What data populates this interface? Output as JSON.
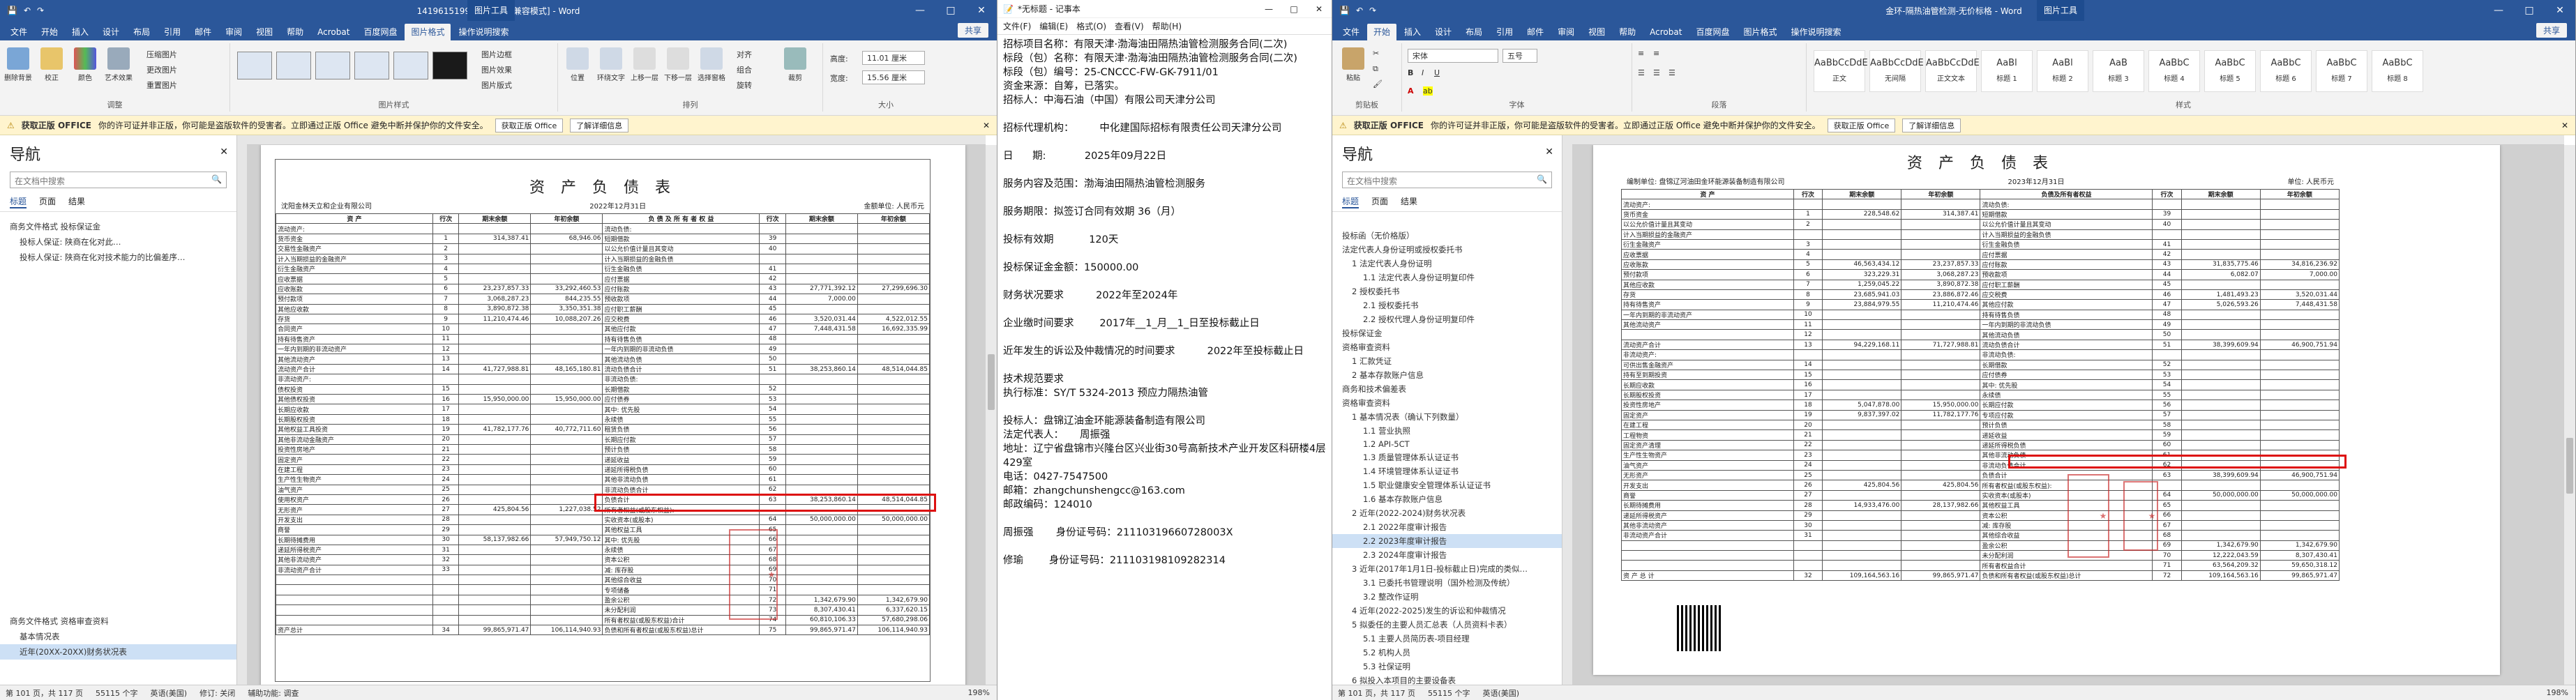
{
  "w1": {
    "title": "14196151993985792 [兼容模式] - Word",
    "context_tab": "图片工具",
    "tabs": [
      "文件",
      "开始",
      "插入",
      "设计",
      "布局",
      "引用",
      "邮件",
      "审阅",
      "视图",
      "帮助",
      "Acrobat",
      "百度网盘",
      "图片格式",
      "操作说明搜索"
    ],
    "active_tab": "图片格式",
    "share": "共享",
    "ribbon": {
      "groups": [
        "调整",
        "图片样式",
        "排列",
        "大小"
      ],
      "adjust_buttons": [
        "删除背景",
        "校正",
        "颜色",
        "艺术效果"
      ],
      "adjust_small": [
        "压缩图片",
        "更改图片",
        "重置图片"
      ],
      "picstyle_small": [
        "图片边框",
        "图片效果",
        "图片版式"
      ],
      "arrange_buttons": [
        "位置",
        "环绕文字",
        "上移一层",
        "下移一层",
        "选择窗格"
      ],
      "arrange_small": [
        "对齐",
        "组合",
        "旋转"
      ],
      "crop": "裁剪",
      "height_label": "高度:",
      "height_value": "11.01 厘米",
      "width_label": "宽度:",
      "width_value": "15.56 厘米"
    },
    "msgbar": {
      "label": "获取正版 OFFICE",
      "text": "你的许可证并非正版，你可能是盗版软件的受害者。立即通过正版 Office 避免中断并保护你的文件安全。",
      "btn1": "获取正版 Office",
      "btn2": "了解详细信息"
    },
    "nav": {
      "title": "导航",
      "search_placeholder": "在文档中搜索",
      "tabs": [
        "标题",
        "页面",
        "结果"
      ],
      "items": [
        "商务文件格式 投标保证金",
        "投标人保证: 陕商在化对此…",
        "投标人保证: 陕商在化对技术能力的比偏差序…",
        "商务文件格式 资格审查资料",
        "基本情况表",
        "近年(20XX-20XX)财务状况表"
      ]
    },
    "status": {
      "page": "第 101 页，共 117 页",
      "words": "55115 个字",
      "lang": "英语(美国)",
      "track": "修订: 关闭",
      "access": "辅助功能: 调查",
      "zoom": "198%"
    },
    "sheet": {
      "title": "资 产 负 债 表",
      "company": "沈阳金林天立和企业有限公司",
      "date": "2022年12月31日",
      "unit": "金额单位: 人民币元",
      "form": "会企01表",
      "headers": [
        "资 产",
        "行次",
        "期末余额",
        "年初余额",
        "负 债 及 所 有 者 权 益",
        "行次",
        "期末余额",
        "年初余额"
      ],
      "rows": [
        [
          "流动资产:",
          "",
          "",
          "",
          "流动负债:",
          "",
          "",
          ""
        ],
        [
          "货币资金",
          "1",
          "314,387.41",
          "68,946.06",
          "短期借款",
          "39",
          "",
          ""
        ],
        [
          "交易性金融资产",
          "2",
          "",
          "",
          "以公允价值计量且其变动",
          "40",
          "",
          ""
        ],
        [
          "计入当期损益的金融资产",
          "3",
          "",
          "",
          "计入当期损益的金融负债",
          "",
          "",
          ""
        ],
        [
          "衍生金融资产",
          "4",
          "",
          "",
          "衍生金融负债",
          "41",
          "",
          ""
        ],
        [
          "应收票据",
          "5",
          "",
          "",
          "应付票据",
          "42",
          "",
          ""
        ],
        [
          "应收账款",
          "6",
          "23,237,857.33",
          "33,292,460.53",
          "应付账款",
          "43",
          "27,771,392.12",
          "27,299,696.30"
        ],
        [
          "预付款项",
          "7",
          "3,068,287.23",
          "844,235.55",
          "预收款项",
          "44",
          "7,000.00",
          ""
        ],
        [
          "其他应收款",
          "8",
          "3,890,872.38",
          "3,350,351.38",
          "应付职工薪酬",
          "45",
          "",
          ""
        ],
        [
          "存货",
          "9",
          "11,210,474.46",
          "10,088,207.26",
          "应交税费",
          "46",
          "3,520,031.44",
          "4,522,012.55"
        ],
        [
          "合同资产",
          "10",
          "",
          "",
          "其他应付款",
          "47",
          "7,448,431.58",
          "16,692,335.99"
        ],
        [
          "持有待售资产",
          "11",
          "",
          "",
          "持有待售负债",
          "48",
          "",
          ""
        ],
        [
          "一年内到期的非流动资产",
          "12",
          "",
          "",
          "一年内到期的非流动负债",
          "49",
          "",
          ""
        ],
        [
          "其他流动资产",
          "13",
          "",
          "",
          "其他流动负债",
          "50",
          "",
          ""
        ],
        [
          "流动资产合计",
          "14",
          "41,727,988.81",
          "48,165,180.81",
          "流动负债合计",
          "51",
          "38,253,860.14",
          "48,514,044.85"
        ],
        [
          "非流动资产:",
          "",
          "",
          "",
          "非流动负债:",
          "",
          "",
          ""
        ],
        [
          "债权投资",
          "15",
          "",
          "",
          "长期借款",
          "52",
          "",
          ""
        ],
        [
          "其他债权投资",
          "16",
          "15,950,000.00",
          "15,950,000.00",
          "应付债券",
          "53",
          "",
          ""
        ],
        [
          "长期应收款",
          "17",
          "",
          "",
          "其中: 优先股",
          "54",
          "",
          ""
        ],
        [
          "长期股权投资",
          "18",
          "",
          "",
          "永续债",
          "55",
          "",
          ""
        ],
        [
          "其他权益工具投资",
          "19",
          "41,782,177.76",
          "40,772,711.60",
          "租赁负债",
          "56",
          "",
          ""
        ],
        [
          "其他非流动金融资产",
          "20",
          "",
          "",
          "长期应付款",
          "57",
          "",
          ""
        ],
        [
          "投资性房地产",
          "21",
          "",
          "",
          "预计负债",
          "58",
          "",
          ""
        ],
        [
          "固定资产",
          "22",
          "",
          "",
          "递延收益",
          "59",
          "",
          ""
        ],
        [
          "在建工程",
          "23",
          "",
          "",
          "递延所得税负债",
          "60",
          "",
          ""
        ],
        [
          "生产性生物资产",
          "24",
          "",
          "",
          "其他非流动负债",
          "61",
          "",
          ""
        ],
        [
          "油气资产",
          "25",
          "",
          "",
          "非流动负债合计",
          "62",
          "",
          ""
        ],
        [
          "使用权资产",
          "26",
          "",
          "",
          "负债合计",
          "63",
          "38,253,860.14",
          "48,514,044.85"
        ],
        [
          "无形资产",
          "27",
          "425,804.56",
          "1,227,038.52",
          "所有者权益(或股东权益):",
          "",
          "",
          ""
        ],
        [
          "开发支出",
          "28",
          "",
          "",
          "实收资本(或股本)",
          "64",
          "50,000,000.00",
          "50,000,000.00"
        ],
        [
          "商誉",
          "29",
          "",
          "",
          "其他权益工具",
          "65",
          "",
          ""
        ],
        [
          "长期待摊费用",
          "30",
          "58,137,982.66",
          "57,949,750.12",
          "其中: 优先股",
          "66",
          "",
          ""
        ],
        [
          "递延所得税资产",
          "31",
          "",
          "",
          "永续债",
          "67",
          "",
          ""
        ],
        [
          "其他非流动资产",
          "32",
          "",
          "",
          "资本公积",
          "68",
          "",
          ""
        ],
        [
          "非流动资产合计",
          "33",
          "",
          "",
          "减: 库存股",
          "69",
          "",
          ""
        ],
        [
          "",
          "",
          "",
          "",
          "其他综合收益",
          "70",
          "",
          ""
        ],
        [
          "",
          "",
          "",
          "",
          "专项储备",
          "71",
          "",
          ""
        ],
        [
          "",
          "",
          "",
          "",
          "盈余公积",
          "72",
          "1,342,679.90",
          "1,342,679.90"
        ],
        [
          "",
          "",
          "",
          "",
          "未分配利润",
          "73",
          "8,307,430.41",
          "6,337,620.15"
        ],
        [
          "",
          "",
          "",
          "",
          "所有者权益(或股东权益)合计",
          "74",
          "60,810,106.33",
          "57,680,298.06"
        ],
        [
          "资产总计",
          "34",
          "99,865,971.47",
          "106,114,940.93",
          "负债和所有者权益(或股东权益)总计",
          "75",
          "99,865,971.47",
          "106,114,940.93"
        ]
      ]
    }
  },
  "w2": {
    "title": "*无标题 - 记事本",
    "menu": [
      "文件(F)",
      "编辑(E)",
      "格式(O)",
      "查看(V)",
      "帮助(H)"
    ],
    "lines": [
      "招标项目名称：有限天津·渤海油田隔热油管检测服务合同(二次)",
      "标段（包）名称：有限天津·渤海油田隔热油管检测服务合同(二次)",
      "标段（包）编号：25-CNCCC-FW-GK-7911/01",
      "资金来源：自筹，已落实。",
      "招标人：中海石油（中国）有限公司天津分公司",
      "",
      "招标代理机构：        中化建国际招标有限责任公司天津分公司",
      "",
      "日      期:            2025年09月22日",
      "",
      "服务内容及范围：渤海油田隔热油管检测服务",
      "",
      "服务期限：拟签订合同有效期 36（月）",
      "",
      "投标有效期           120天",
      "",
      "投标保证金金额：150000.00",
      "",
      "财务状况要求          2022年至2024年",
      "",
      "企业缴时间要求        2017年__1_月__1_日至投标截止日",
      "",
      "近年发生的诉讼及仲裁情况的时间要求          2022年至投标截止日",
      "",
      "技术规范要求",
      "执行标准：SY/T 5324-2013 预应力隔热油管",
      "",
      "投标人：盘锦辽油金环能源装备制造有限公司",
      "法定代表人：     周振强",
      "地址：辽宁省盘锦市兴隆台区兴业街30号高新技术产业开发区科研楼4层429室",
      "电话：0427-7547500",
      "邮箱：zhangchunshengcc@163.com",
      "邮政编码：124010",
      "",
      "周振强       身份证号码：21110319660728003X",
      "",
      "修瑜        身份证号码：211103198109282314"
    ]
  },
  "w3": {
    "title": "金环-隔热油管检测-无价标格 - Word",
    "context_tab": "图片工具",
    "tabs": [
      "文件",
      "开始",
      "插入",
      "设计",
      "布局",
      "引用",
      "邮件",
      "审阅",
      "视图",
      "帮助",
      "Acrobat",
      "百度网盘",
      "图片格式",
      "操作说明搜索"
    ],
    "active_tab": "开始",
    "share": "共享",
    "ribbon": {
      "groups": [
        "剪贴板",
        "字体",
        "段落",
        "样式"
      ],
      "paste": "粘贴",
      "font_name": "宋体",
      "font_size": "五号",
      "styles": [
        "AaBbCcDdE",
        "AaBbCcDdE",
        "AaBbCcDdE",
        "AaBl",
        "AaBl",
        "AaB",
        "AaBbC",
        "AaBbC",
        "AaBbC",
        "AaBbC",
        "AaBbC"
      ],
      "style_names": [
        "正文",
        "无间隔",
        "正文文本",
        "标题 1",
        "标题 2",
        "标题 3",
        "标题 4",
        "标题 5",
        "标题 6",
        "标题 7",
        "标题 8"
      ]
    },
    "msgbar": {
      "label": "获取正版 OFFICE",
      "text": "你的许可证并非正版，你可能是盗版软件的受害者。立即通过正版 Office 避免中断并保护你的文件安全。",
      "btn1": "获取正版 Office",
      "btn2": "了解详细信息"
    },
    "nav": {
      "title": "导航",
      "search_placeholder": "在文档中搜索",
      "tabs": [
        "标题",
        "页面",
        "结果"
      ],
      "items": [
        "投标函（无价格版）",
        "法定代表人身份证明或授权委托书",
        "1 法定代表人身份证明",
        "1.1 法定代表人身份证明复印件",
        "2 授权委托书",
        "2.1 授权委托书",
        "2.2 授权代理人身份证明复印件",
        "投标保证金",
        "资格审查资料",
        "1 汇款凭证",
        "2 基本存款账户信息",
        "商务和技术偏差表",
        "资格审查资料",
        "1 基本情况表（确认下列数量）",
        "1.1 营业执照",
        "1.2 API-5CT",
        "1.3 质量管理体系认证证书",
        "1.4 环境管理体系认证证书",
        "1.5 职业健康安全管理体系认证证书",
        "1.6 基本存款账户信息",
        "2 近年(2022-2024)财务状况表",
        "2.1 2022年度审计报告",
        "2.2 2023年度审计报告",
        "2.3 2024年度审计报告",
        "3 近年(2017年1月1日-投标截止日)完成的类似…",
        "3.1 已委托书管理说明（国外检测及传统）",
        "3.2 整改作证明",
        "4 近年(2022-2025)发生的诉讼和仲裁情况",
        "5 拟委任的主要人员汇总表（人员资料卡表）",
        "5.1 主要人员简历表-项目经理",
        "5.2 机构人员",
        "5.3 社保证明",
        "6 拟投入本项目的主要设备表"
      ]
    },
    "status": {
      "page": "第 101 页，共 117 页",
      "words": "55115 个字",
      "lang": "英语(美国)",
      "zoom": "198%"
    },
    "sheet": {
      "title": "资 产 负 债 表",
      "company": "编制单位: 盘锦辽河油田金环能源装备制造有限公司",
      "date": "2023年12月31日",
      "unit": "单位: 人民币元",
      "form": "会企01表",
      "headers": [
        "资 产",
        "行次",
        "期末余额",
        "年初余额",
        "负债及所有者权益",
        "行次",
        "期末余额",
        "年初余额"
      ],
      "rows": [
        [
          "流动资产:",
          "",
          "",
          "",
          "流动负债:",
          "",
          "",
          ""
        ],
        [
          "货币资金",
          "1",
          "228,548.62",
          "314,387.41",
          "短期借款",
          "39",
          "",
          ""
        ],
        [
          "以公允价值计量且其变动",
          "2",
          "",
          "",
          "以公允价值计量且其变动",
          "40",
          "",
          ""
        ],
        [
          "计入当期损益的金融资产",
          "",
          "",
          "",
          "计入当期损益的金融负债",
          "",
          "",
          ""
        ],
        [
          "衍生金融资产",
          "3",
          "",
          "",
          "衍生金融负债",
          "41",
          "",
          ""
        ],
        [
          "应收票据",
          "4",
          "",
          "",
          "应付票据",
          "42",
          "",
          ""
        ],
        [
          "应收账款",
          "5",
          "46,563,434.12",
          "23,237,857.33",
          "应付账款",
          "43",
          "31,835,775.46",
          "34,816,236.92"
        ],
        [
          "预付款项",
          "6",
          "323,229.31",
          "3,068,287.23",
          "预收款项",
          "44",
          "6,082.07",
          "7,000.00"
        ],
        [
          "其他应收款",
          "7",
          "1,259,045.22",
          "3,890,872.38",
          "应付职工薪酬",
          "45",
          "",
          ""
        ],
        [
          "存货",
          "8",
          "23,685,941.03",
          "23,886,872.46",
          "应交税费",
          "46",
          "1,481,493.23",
          "3,520,031.44"
        ],
        [
          "持有待售资产",
          "9",
          "23,884,979.55",
          "11,210,474.46",
          "其他应付款",
          "47",
          "5,026,593.26",
          "7,448,431.58"
        ],
        [
          "一年内到期的非流动资产",
          "10",
          "",
          "",
          "持有待售负债",
          "48",
          "",
          ""
        ],
        [
          "其他流动资产",
          "11",
          "",
          "",
          "一年内到期的非流动负债",
          "49",
          "",
          ""
        ],
        [
          "",
          "12",
          "",
          "",
          "其他流动负债",
          "50",
          "",
          ""
        ],
        [
          "流动资产合计",
          "13",
          "94,229,168.11",
          "71,727,988.81",
          "流动负债合计",
          "51",
          "38,399,609.94",
          "46,900,751.94"
        ],
        [
          "非流动资产:",
          "",
          "",
          "",
          "非流动负债:",
          "",
          "",
          ""
        ],
        [
          "可供出售金融资产",
          "14",
          "",
          "",
          "长期借款",
          "52",
          "",
          ""
        ],
        [
          "持有至到期投资",
          "15",
          "",
          "",
          "应付债券",
          "53",
          "",
          ""
        ],
        [
          "长期应收款",
          "16",
          "",
          "",
          "其中: 优先股",
          "54",
          "",
          ""
        ],
        [
          "长期股权投资",
          "17",
          "",
          "",
          "永续债",
          "55",
          "",
          ""
        ],
        [
          "投资性房地产",
          "18",
          "5,047,878.00",
          "15,950,000.00",
          "长期应付款",
          "56",
          "",
          ""
        ],
        [
          "固定资产",
          "19",
          "9,837,397.02",
          "11,782,177.76",
          "专项应付款",
          "57",
          "",
          ""
        ],
        [
          "在建工程",
          "20",
          "",
          "",
          "预计负债",
          "58",
          "",
          ""
        ],
        [
          "工程物资",
          "21",
          "",
          "",
          "递延收益",
          "59",
          "",
          ""
        ],
        [
          "固定资产清理",
          "22",
          "",
          "",
          "递延所得税负债",
          "60",
          "",
          ""
        ],
        [
          "生产性生物资产",
          "23",
          "",
          "",
          "其他非流动负债",
          "61",
          "",
          ""
        ],
        [
          "油气资产",
          "24",
          "",
          "",
          "非流动负债合计",
          "62",
          "",
          ""
        ],
        [
          "无形资产",
          "25",
          "",
          "",
          "负债合计",
          "63",
          "38,399,609.94",
          "46,900,751.94"
        ],
        [
          "开发支出",
          "26",
          "425,804.56",
          "425,804.56",
          "所有者权益(或股东权益):",
          "",
          "",
          ""
        ],
        [
          "商誉",
          "27",
          "",
          "",
          "实收资本(或股本)",
          "64",
          "50,000,000.00",
          "50,000,000.00"
        ],
        [
          "长期待摊费用",
          "28",
          "14,933,476.00",
          "28,137,982.66",
          "其他权益工具",
          "65",
          "",
          ""
        ],
        [
          "递延所得税资产",
          "29",
          "",
          "",
          "资本公积",
          "66",
          "",
          ""
        ],
        [
          "其他非流动资产",
          "30",
          "",
          "",
          "减: 库存股",
          "67",
          "",
          ""
        ],
        [
          "非流动资产合计",
          "31",
          "",
          "",
          "其他综合收益",
          "68",
          "",
          ""
        ],
        [
          "",
          "",
          "",
          "",
          "盈余公积",
          "69",
          "1,342,679.90",
          "1,342,679.90"
        ],
        [
          "",
          "",
          "",
          "",
          "未分配利润",
          "70",
          "12,222,043.59",
          "8,307,430.41"
        ],
        [
          "",
          "",
          "",
          "",
          "所有者权益合计",
          "71",
          "63,564,209.32",
          "59,650,318.12"
        ],
        [
          "资 产 总 计",
          "32",
          "109,164,563.16",
          "99,865,971.47",
          "负债和所有者权益(或股东权益)总计",
          "72",
          "109,164,563.16",
          "99,865,971.47"
        ]
      ]
    }
  }
}
